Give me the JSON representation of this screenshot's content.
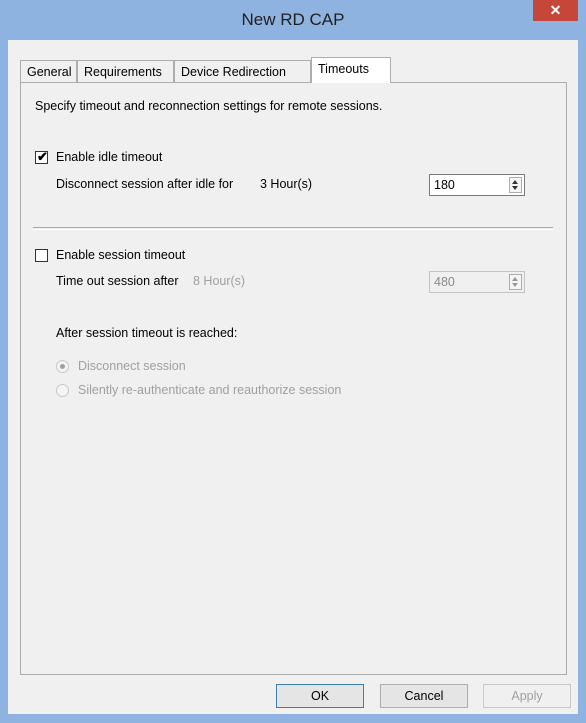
{
  "window": {
    "title": "New RD CAP",
    "close_glyph": "✕"
  },
  "tabs": [
    {
      "label": "General"
    },
    {
      "label": "Requirements"
    },
    {
      "label": "Device Redirection"
    },
    {
      "label": "Timeouts"
    }
  ],
  "active_tab": "Timeouts",
  "timeouts": {
    "description": "Specify timeout and reconnection settings for remote sessions.",
    "idle": {
      "checkbox_label": "Enable idle timeout",
      "checked": true,
      "label": "Disconnect session after idle for",
      "hours_text": "3 Hour(s)",
      "value": "180"
    },
    "session": {
      "checkbox_label": "Enable session timeout",
      "checked": false,
      "label": "Time out session after",
      "hours_text": "8 Hour(s)",
      "value": "480"
    },
    "after_label": "After session timeout is reached:",
    "radio_options": [
      {
        "label": "Disconnect session",
        "selected": true
      },
      {
        "label": "Silently re-authenticate and reauthorize session",
        "selected": false
      }
    ]
  },
  "buttons": {
    "ok": "OK",
    "cancel": "Cancel",
    "apply": "Apply"
  },
  "colors": {
    "frame": "#8fb3e0",
    "close": "#c7463a",
    "dialog_bg": "#f0f0f0"
  }
}
